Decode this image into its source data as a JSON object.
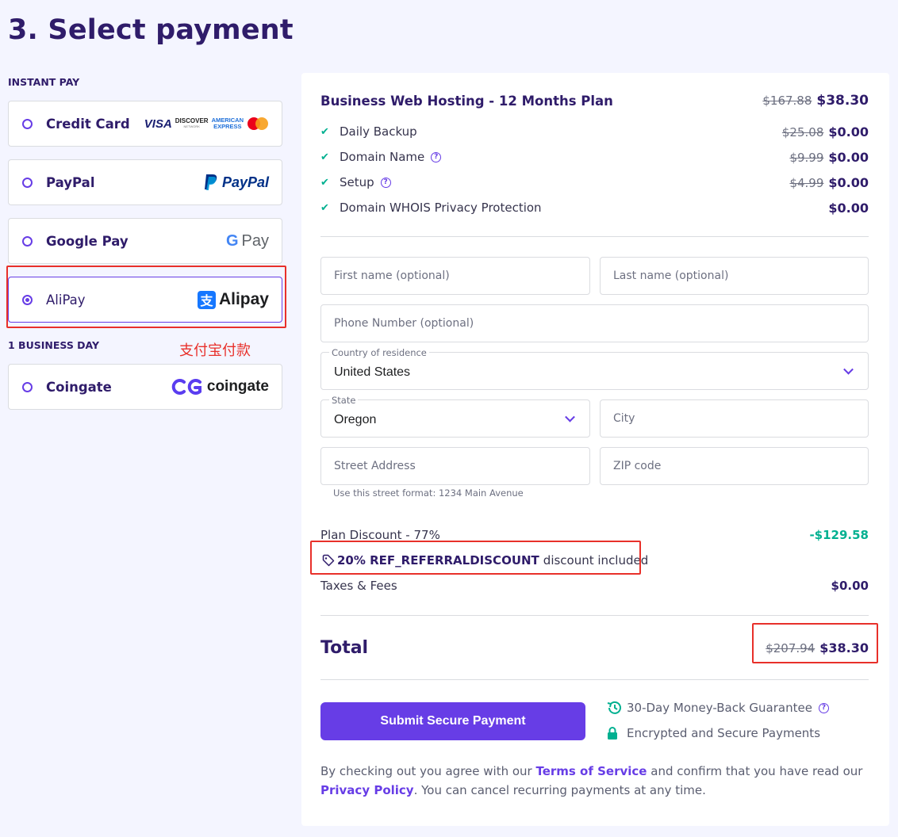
{
  "page": {
    "title": "3. Select payment"
  },
  "sections": {
    "instant": "INSTANT PAY",
    "business_day": "1 BUSINESS DAY"
  },
  "methods": [
    {
      "label": "Credit Card",
      "selected": false
    },
    {
      "label": "PayPal",
      "selected": false
    },
    {
      "label": "Google Pay",
      "selected": false
    },
    {
      "label": "AliPay",
      "selected": true
    },
    {
      "label": "Coingate",
      "selected": false
    }
  ],
  "logos": {
    "visa": "VISA",
    "discover": "DISCOVER",
    "discover_sub": "NETWORK",
    "amex_top": "AMERICAN",
    "amex_bottom": "EXPRESS",
    "paypal": "PayPal",
    "gpay_g": "G",
    "gpay_pay": "Pay",
    "alipay_mark": "支",
    "alipay": "Alipay",
    "coingate": "coingate"
  },
  "annotation": {
    "alipay_note": "支付宝付款"
  },
  "order": {
    "plan": {
      "name": "Business Web Hosting - 12 Months Plan",
      "old_price": "$167.88",
      "price": "$38.30"
    },
    "features": [
      {
        "label": "Daily Backup",
        "old_price": "$25.08",
        "price": "$0.00",
        "help": false
      },
      {
        "label": "Domain Name",
        "old_price": "$9.99",
        "price": "$0.00",
        "help": true
      },
      {
        "label": "Setup",
        "old_price": "$4.99",
        "price": "$0.00",
        "help": true
      },
      {
        "label": "Domain WHOIS Privacy Protection",
        "old_price": "",
        "price": "$0.00",
        "help": false
      }
    ]
  },
  "form": {
    "first_name": {
      "placeholder": "First name (optional)"
    },
    "last_name": {
      "placeholder": "Last name (optional)"
    },
    "phone": {
      "placeholder": "Phone Number (optional)"
    },
    "country": {
      "caption": "Country of residence",
      "value": "United States"
    },
    "state": {
      "caption": "State",
      "value": "Oregon"
    },
    "city": {
      "placeholder": "City"
    },
    "street": {
      "placeholder": "Street Address",
      "hint": "Use this street format: 1234 Main Avenue"
    },
    "zip": {
      "placeholder": "ZIP code"
    }
  },
  "summary": {
    "plan_discount_label": "Plan Discount - 77%",
    "plan_discount_value": "-$129.58",
    "coupon_code": "20% REF_REFERRALDISCOUNT",
    "coupon_suffix": "discount included",
    "taxes_label": "Taxes & Fees",
    "taxes_value": "$0.00",
    "total_label": "Total",
    "total_old": "$207.94",
    "total_value": "$38.30"
  },
  "actions": {
    "submit": "Submit Secure Payment",
    "guarantee": "30-Day Money-Back Guarantee",
    "secure": "Encrypted and Secure Payments"
  },
  "legal": {
    "prefix": "By checking out you agree with our ",
    "tos": "Terms of Service",
    "middle": " and confirm that you have read our ",
    "privacy": "Privacy Policy",
    "suffix": ". You can cancel recurring payments at any time."
  },
  "colors": {
    "primary": "#673de6",
    "success": "#00b090",
    "annotation": "#e8302a",
    "heading": "#2f1c6a"
  }
}
